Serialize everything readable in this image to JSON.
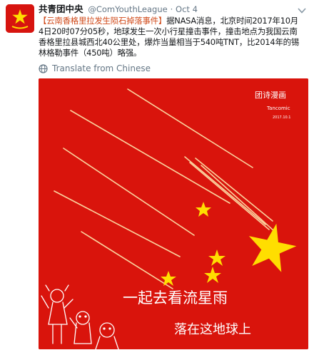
{
  "tweet": {
    "author_name": "共青团中央",
    "handle": "@ComYouthLeague",
    "separator": "·",
    "date": "Oct 4",
    "text_title": "【云南香格里拉发生陨石掉落事件】",
    "text_line1_rest": "据NASA消息，北京时间2017年10月",
    "text_line2": "4日20时07分05秒，地球发生一次小行星撞击事件，撞击地点为我国云南",
    "text_line3": "香格里拉县城西北40公里处，爆炸当量相当于540吨TNT，比2014年的锡",
    "text_line4": "林格勒事件（450吨）略强。",
    "translate_label": "Translate from Chinese"
  },
  "media": {
    "signature_line1": "团诗漫画",
    "signature_line2": "Tancomic",
    "signature_date": "2017.10.1",
    "caption_line1": "一起去看流星雨",
    "caption_line2": "落在这地球上"
  },
  "icons": {
    "avatar": "youth-league-emblem-icon",
    "menu": "chevron-down-icon",
    "translate": "globe-icon"
  },
  "colors": {
    "flag_red": "#d9140c",
    "star_yellow": "#ffde00",
    "link_orange": "#d04a1a",
    "muted": "#657786"
  }
}
